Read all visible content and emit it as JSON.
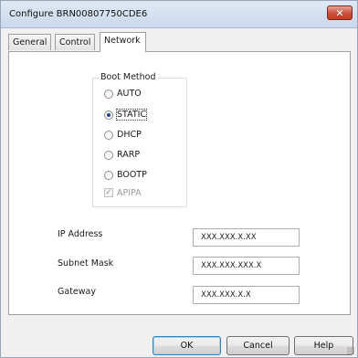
{
  "window": {
    "title": "Configure BRN00807750CDE6",
    "close_label": "✕"
  },
  "tabs": [
    {
      "label": "General",
      "active": false
    },
    {
      "label": "Control",
      "active": false
    },
    {
      "label": "Network",
      "active": true
    }
  ],
  "boot_method": {
    "title": "Boot Method",
    "options": [
      {
        "label": "AUTO",
        "selected": false
      },
      {
        "label": "STATIC",
        "selected": true
      },
      {
        "label": "DHCP",
        "selected": false
      },
      {
        "label": "RARP",
        "selected": false
      },
      {
        "label": "BOOTP",
        "selected": false
      }
    ],
    "apipa": {
      "label": "APIPA",
      "checked": true,
      "enabled": false
    }
  },
  "fields": {
    "ip_address": {
      "label": "IP Address",
      "value": "XXX.XXX.X.XX"
    },
    "subnet_mask": {
      "label": "Subnet Mask",
      "value": "XXX.XXX.XXX.X"
    },
    "gateway": {
      "label": "Gateway",
      "value": "XXX.XXX.X.X"
    }
  },
  "buttons": {
    "ok": "OK",
    "cancel": "Cancel",
    "help": "Help"
  },
  "colors": {
    "close_button": "#c7503a",
    "radio_dot": "#27448a",
    "default_button_border": "#3c7fb1"
  }
}
